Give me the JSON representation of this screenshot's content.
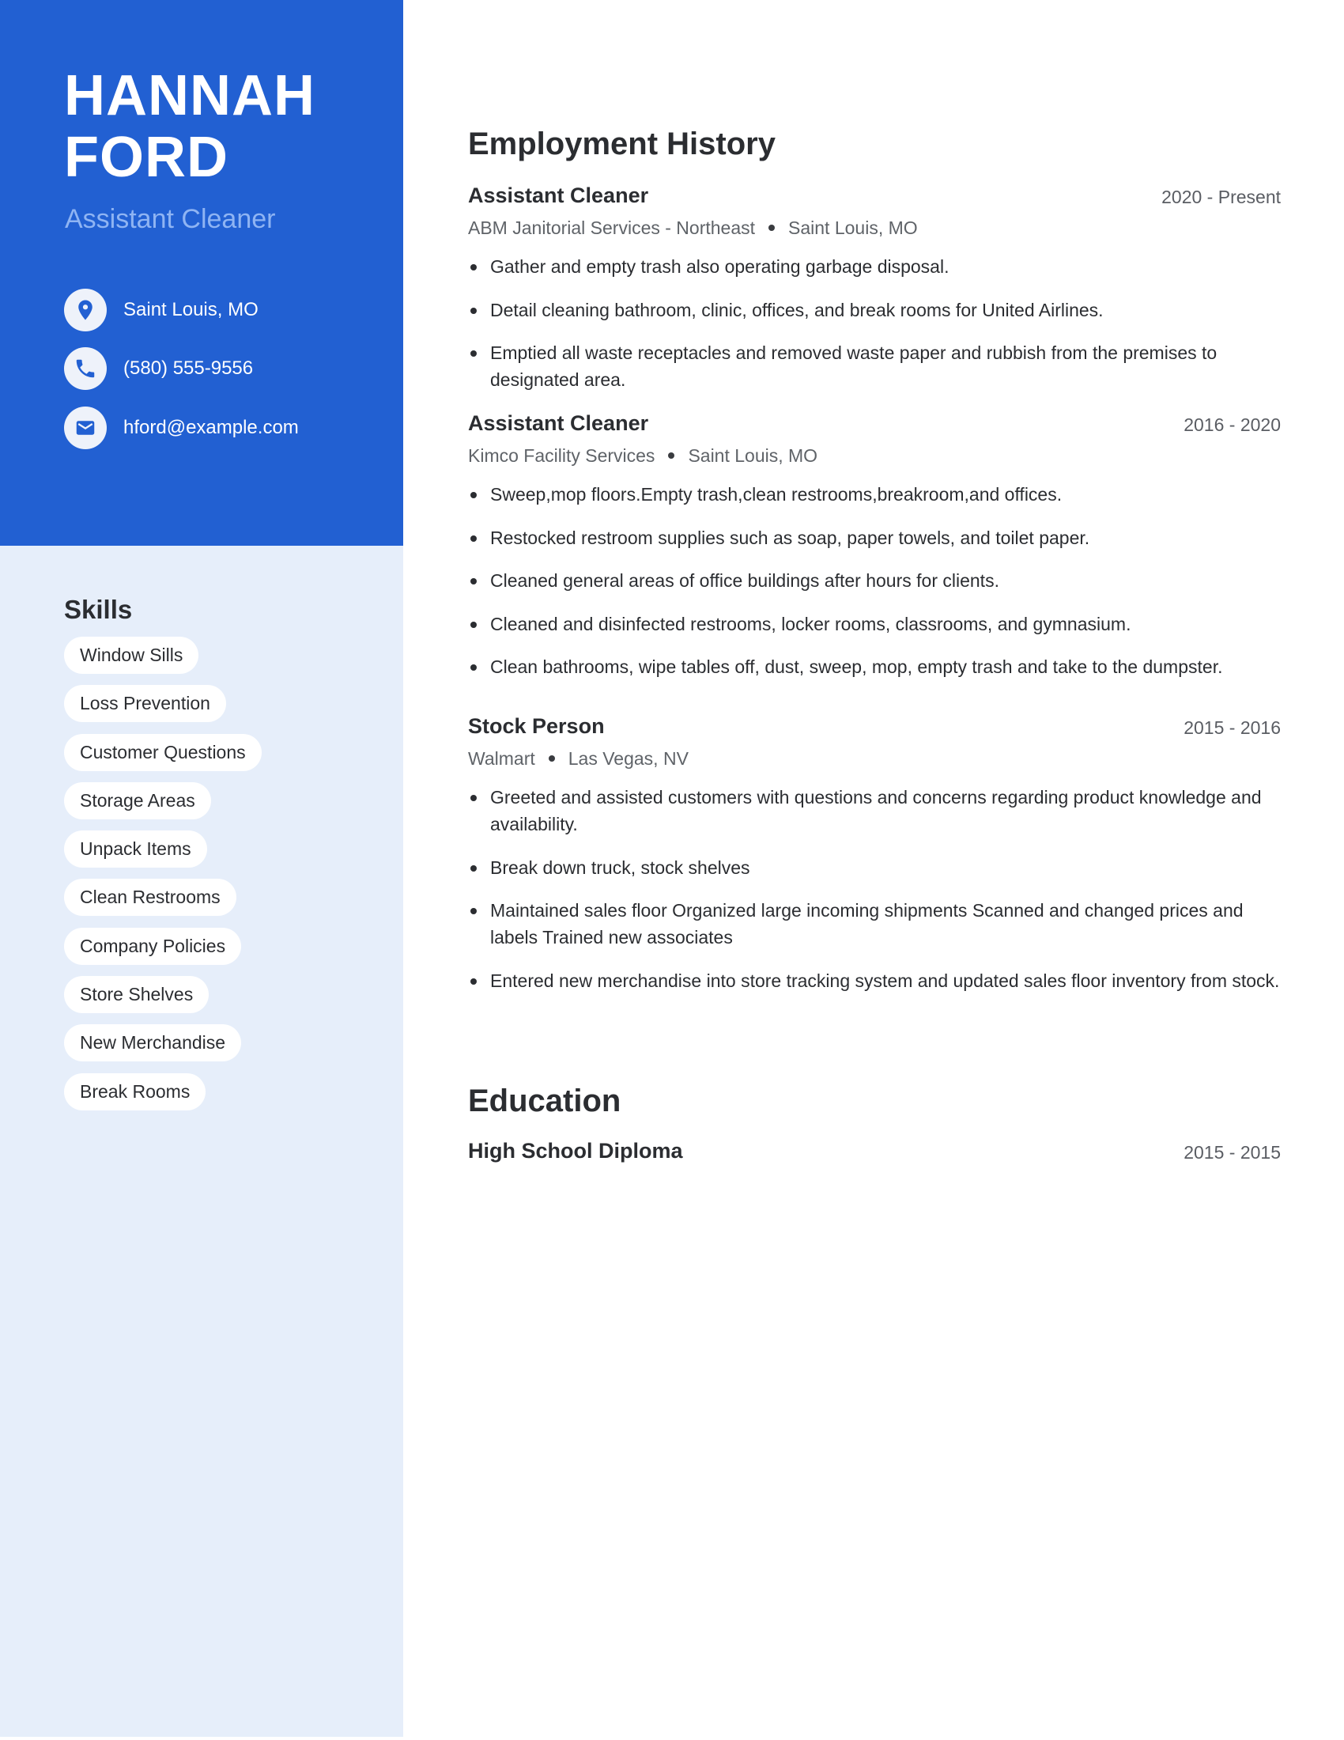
{
  "profile": {
    "first_name": "HANNAH",
    "last_name": "FORD",
    "role": "Assistant Cleaner"
  },
  "contact": [
    {
      "icon": "location-pin-icon",
      "label": "Saint Louis, MO"
    },
    {
      "icon": "phone-icon",
      "label": "(580) 555-9556"
    },
    {
      "icon": "email-icon",
      "label": "hford@example.com"
    }
  ],
  "skills": {
    "title": "Skills",
    "items": [
      "Window Sills",
      "Loss Prevention",
      "Customer Questions",
      "Storage Areas",
      "Unpack Items",
      "Clean Restrooms",
      "Company Policies",
      "Store Shelves",
      "New Merchandise",
      "Break Rooms"
    ]
  },
  "employment": {
    "title": "Employment History",
    "jobs": [
      {
        "title": "Assistant Cleaner",
        "dates": "2020 - Present",
        "company": "ABM Janitorial Services - Northeast",
        "location": "Saint Louis, MO",
        "bullets": [
          "Gather and empty trash also operating garbage disposal.",
          "Detail cleaning bathroom, clinic, offices, and break rooms for United Airlines.",
          "Emptied all waste receptacles and removed waste paper and rubbish from the premises to designated area."
        ]
      },
      {
        "title": "Assistant Cleaner",
        "dates": "2016 - 2020",
        "company": "Kimco Facility Services",
        "location": "Saint Louis, MO",
        "bullets": [
          "Sweep,mop floors.Empty trash,clean restrooms,breakroom,and offices.",
          "Restocked restroom supplies such as soap, paper towels, and toilet paper.",
          "Cleaned general areas of office buildings after hours for clients.",
          "Cleaned and disinfected restrooms, locker rooms, classrooms, and gymnasium.",
          "Clean bathrooms, wipe tables off, dust, sweep, mop, empty trash and take to the dumpster."
        ]
      },
      {
        "title": "Stock Person",
        "dates": "2015 - 2016",
        "company": "Walmart",
        "location": "Las Vegas, NV",
        "bullets": [
          "Greeted and assisted customers with questions and concerns regarding product knowledge and availability.",
          "Break down truck, stock shelves",
          "Maintained sales floor Organized large incoming shipments Scanned and changed prices and labels Trained new associates",
          "Entered new merchandise into store tracking system and updated sales floor inventory from stock."
        ]
      }
    ]
  },
  "education": {
    "title": "Education",
    "items": [
      {
        "title": "High School Diploma",
        "dates": "2015 - 2015"
      }
    ]
  },
  "colors": {
    "accent": "#2260d2",
    "sidebar_bg": "#e6eefa",
    "role_text": "#8fb4f3",
    "text": "#2b2d31"
  }
}
